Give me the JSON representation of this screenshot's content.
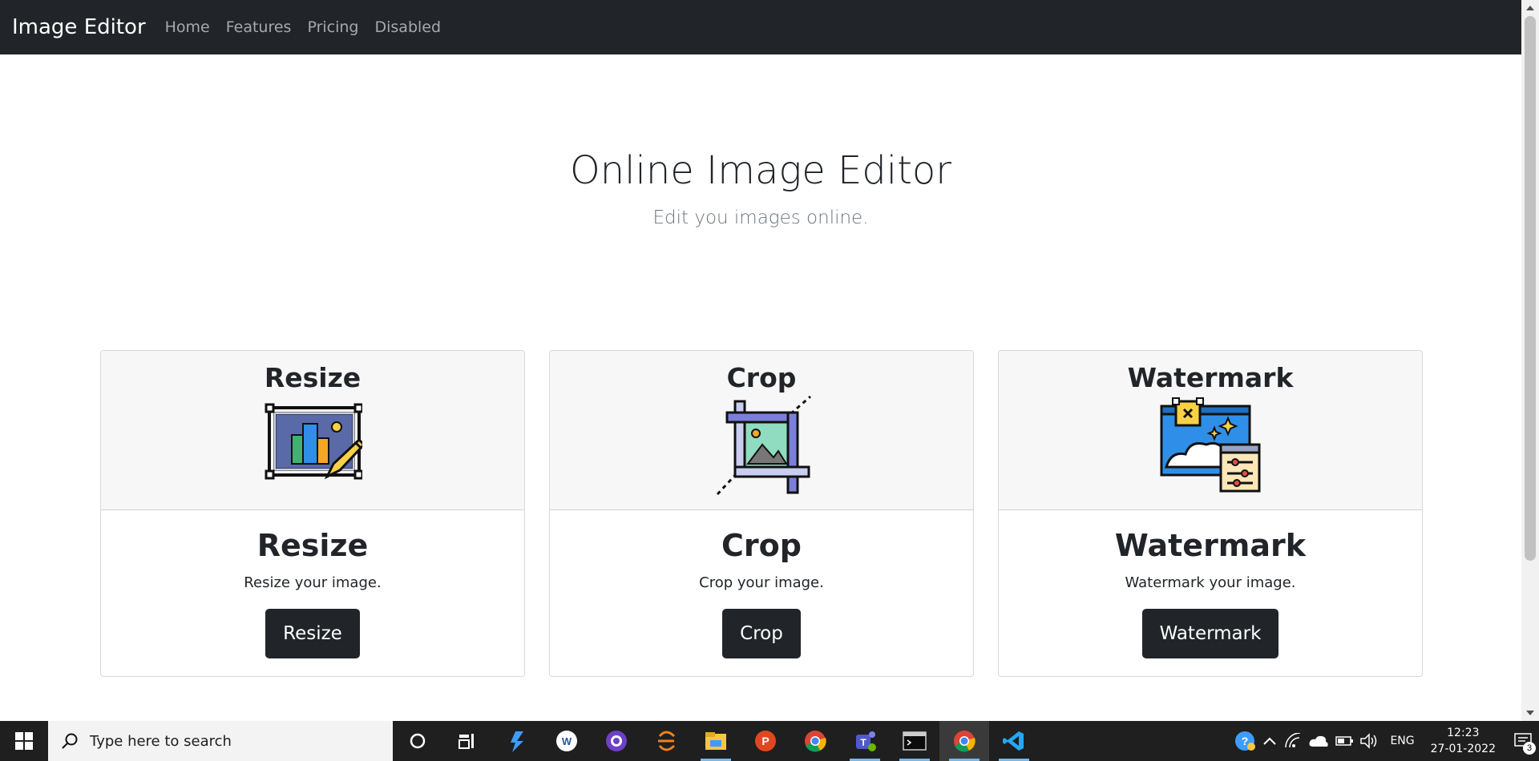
{
  "navbar": {
    "brand": "Image Editor",
    "links": [
      "Home",
      "Features",
      "Pricing",
      "Disabled"
    ]
  },
  "hero": {
    "title": "Online Image Editor",
    "subtitle": "Edit you images online."
  },
  "cards": [
    {
      "header": "Resize",
      "title": "Resize",
      "text": "Resize your image.",
      "button": "Resize",
      "icon": "resize-icon"
    },
    {
      "header": "Crop",
      "title": "Crop",
      "text": "Crop your image.",
      "button": "Crop",
      "icon": "crop-icon"
    },
    {
      "header": "Watermark",
      "title": "Watermark",
      "text": "Watermark your image.",
      "button": "Watermark",
      "icon": "watermark-icon"
    }
  ],
  "taskbar": {
    "search_placeholder": "Type here to search",
    "apps": [
      "cortana-icon",
      "task-view-icon",
      "azure-data-studio-icon",
      "word-icon",
      "github-desktop-icon",
      "eclipse-icon",
      "file-explorer-icon",
      "postman-icon",
      "chrome-icon",
      "teams-icon",
      "terminal-icon",
      "chrome-active-icon",
      "vscode-icon"
    ],
    "language": "ENG",
    "time": "12:23",
    "date": "27-01-2022",
    "notification_count": "3"
  },
  "colors": {
    "navbar_bg": "#212529",
    "button_bg": "#212529",
    "card_header_bg": "#f7f7f7",
    "taskbar_bg": "#1f1f1f"
  }
}
